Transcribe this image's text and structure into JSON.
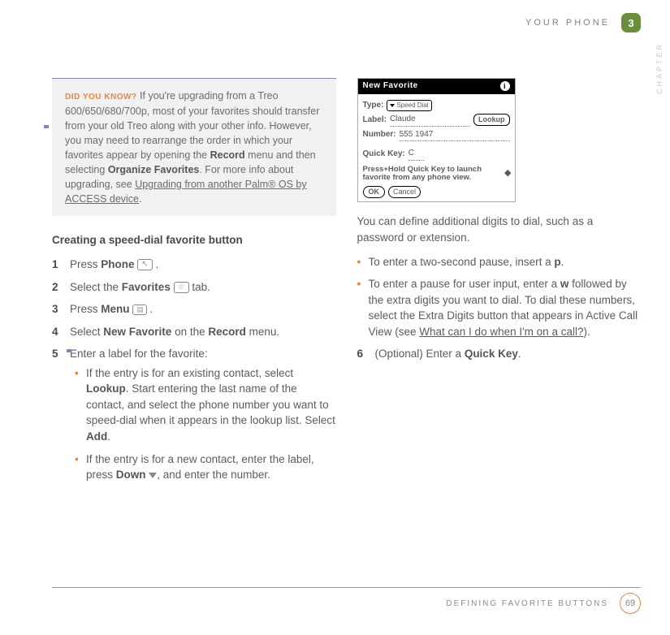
{
  "header": {
    "section": "YOUR PHONE",
    "chapter_number": "3",
    "side_label": "CHAPTER"
  },
  "footer": {
    "section": "DEFINING FAVORITE BUTTONS",
    "page": "69"
  },
  "dyk": {
    "label": "DID YOU KNOW?",
    "text1": " If you're upgrading from a Treo 600/650/680/700p, most of your favorites should transfer from your old Treo along with your other info. However, you may need to rearrange the order in which your favorites appear by opening the ",
    "bold1": "Record",
    "text2": " menu and then selecting ",
    "bold2": "Organize Favorites",
    "text3": ". For more info about upgrading, see ",
    "link": "Upgrading from another Palm® OS by ACCESS device",
    "text4": "."
  },
  "section_title": "Creating a speed-dial favorite button",
  "steps": {
    "s1a": "Press ",
    "s1b": "Phone",
    "s1c": " .",
    "s2a": "Select the ",
    "s2b": "Favorites",
    "s2c": " tab.",
    "s3a": "Press ",
    "s3b": "Menu",
    "s3c": " .",
    "s4a": "Select ",
    "s4b": "New Favorite",
    "s4c": " on the ",
    "s4d": "Record",
    "s4e": " menu.",
    "s5": "Enter a label for the favorite:",
    "s5_b1a": "If the entry is for an existing contact, select ",
    "s5_b1b": "Lookup",
    "s5_b1c": ". Start entering the last name of the contact, and select the phone number you want to speed-dial when it appears in the lookup list. Select ",
    "s5_b1d": "Add",
    "s5_b1e": ".",
    "s5_b2a": "If the entry is for a new contact, enter the label, press ",
    "s5_b2b": "Down",
    "s5_b2c": ", and enter the number.",
    "s6a": "(Optional)  Enter a ",
    "s6b": "Quick Key",
    "s6c": "."
  },
  "num": {
    "n1": "1",
    "n2": "2",
    "n3": "3",
    "n4": "4",
    "n5": "5",
    "n6": "6"
  },
  "right": {
    "para1": "You can define additional digits to dial, such as a password or extension.",
    "b1a": "To enter a two-second pause, insert a ",
    "b1b": "p",
    "b1c": ".",
    "b2a": "To enter a pause for user input, enter a ",
    "b2b": "w",
    "b2c": " followed by the extra digits you want to dial. To dial these numbers, select the Extra Digits button that appears in Active Call View (see ",
    "b2d": "What can I do when I'm on a call?",
    "b2e": ")."
  },
  "shot": {
    "title": "New Favorite",
    "type_label": "Type:",
    "type_value": "Speed Dial",
    "label_label": "Label:",
    "label_value": "Claude",
    "lookup": "Lookup",
    "number_label": "Number:",
    "number_value": "555 1947",
    "quick_label": "Quick Key:",
    "quick_value": "C",
    "hint": "Press+Hold Quick Key to launch favorite from any phone view.",
    "ok": "OK",
    "cancel": "Cancel"
  },
  "icons": {
    "phone": "↖",
    "star": "☆",
    "menu": "▤"
  }
}
